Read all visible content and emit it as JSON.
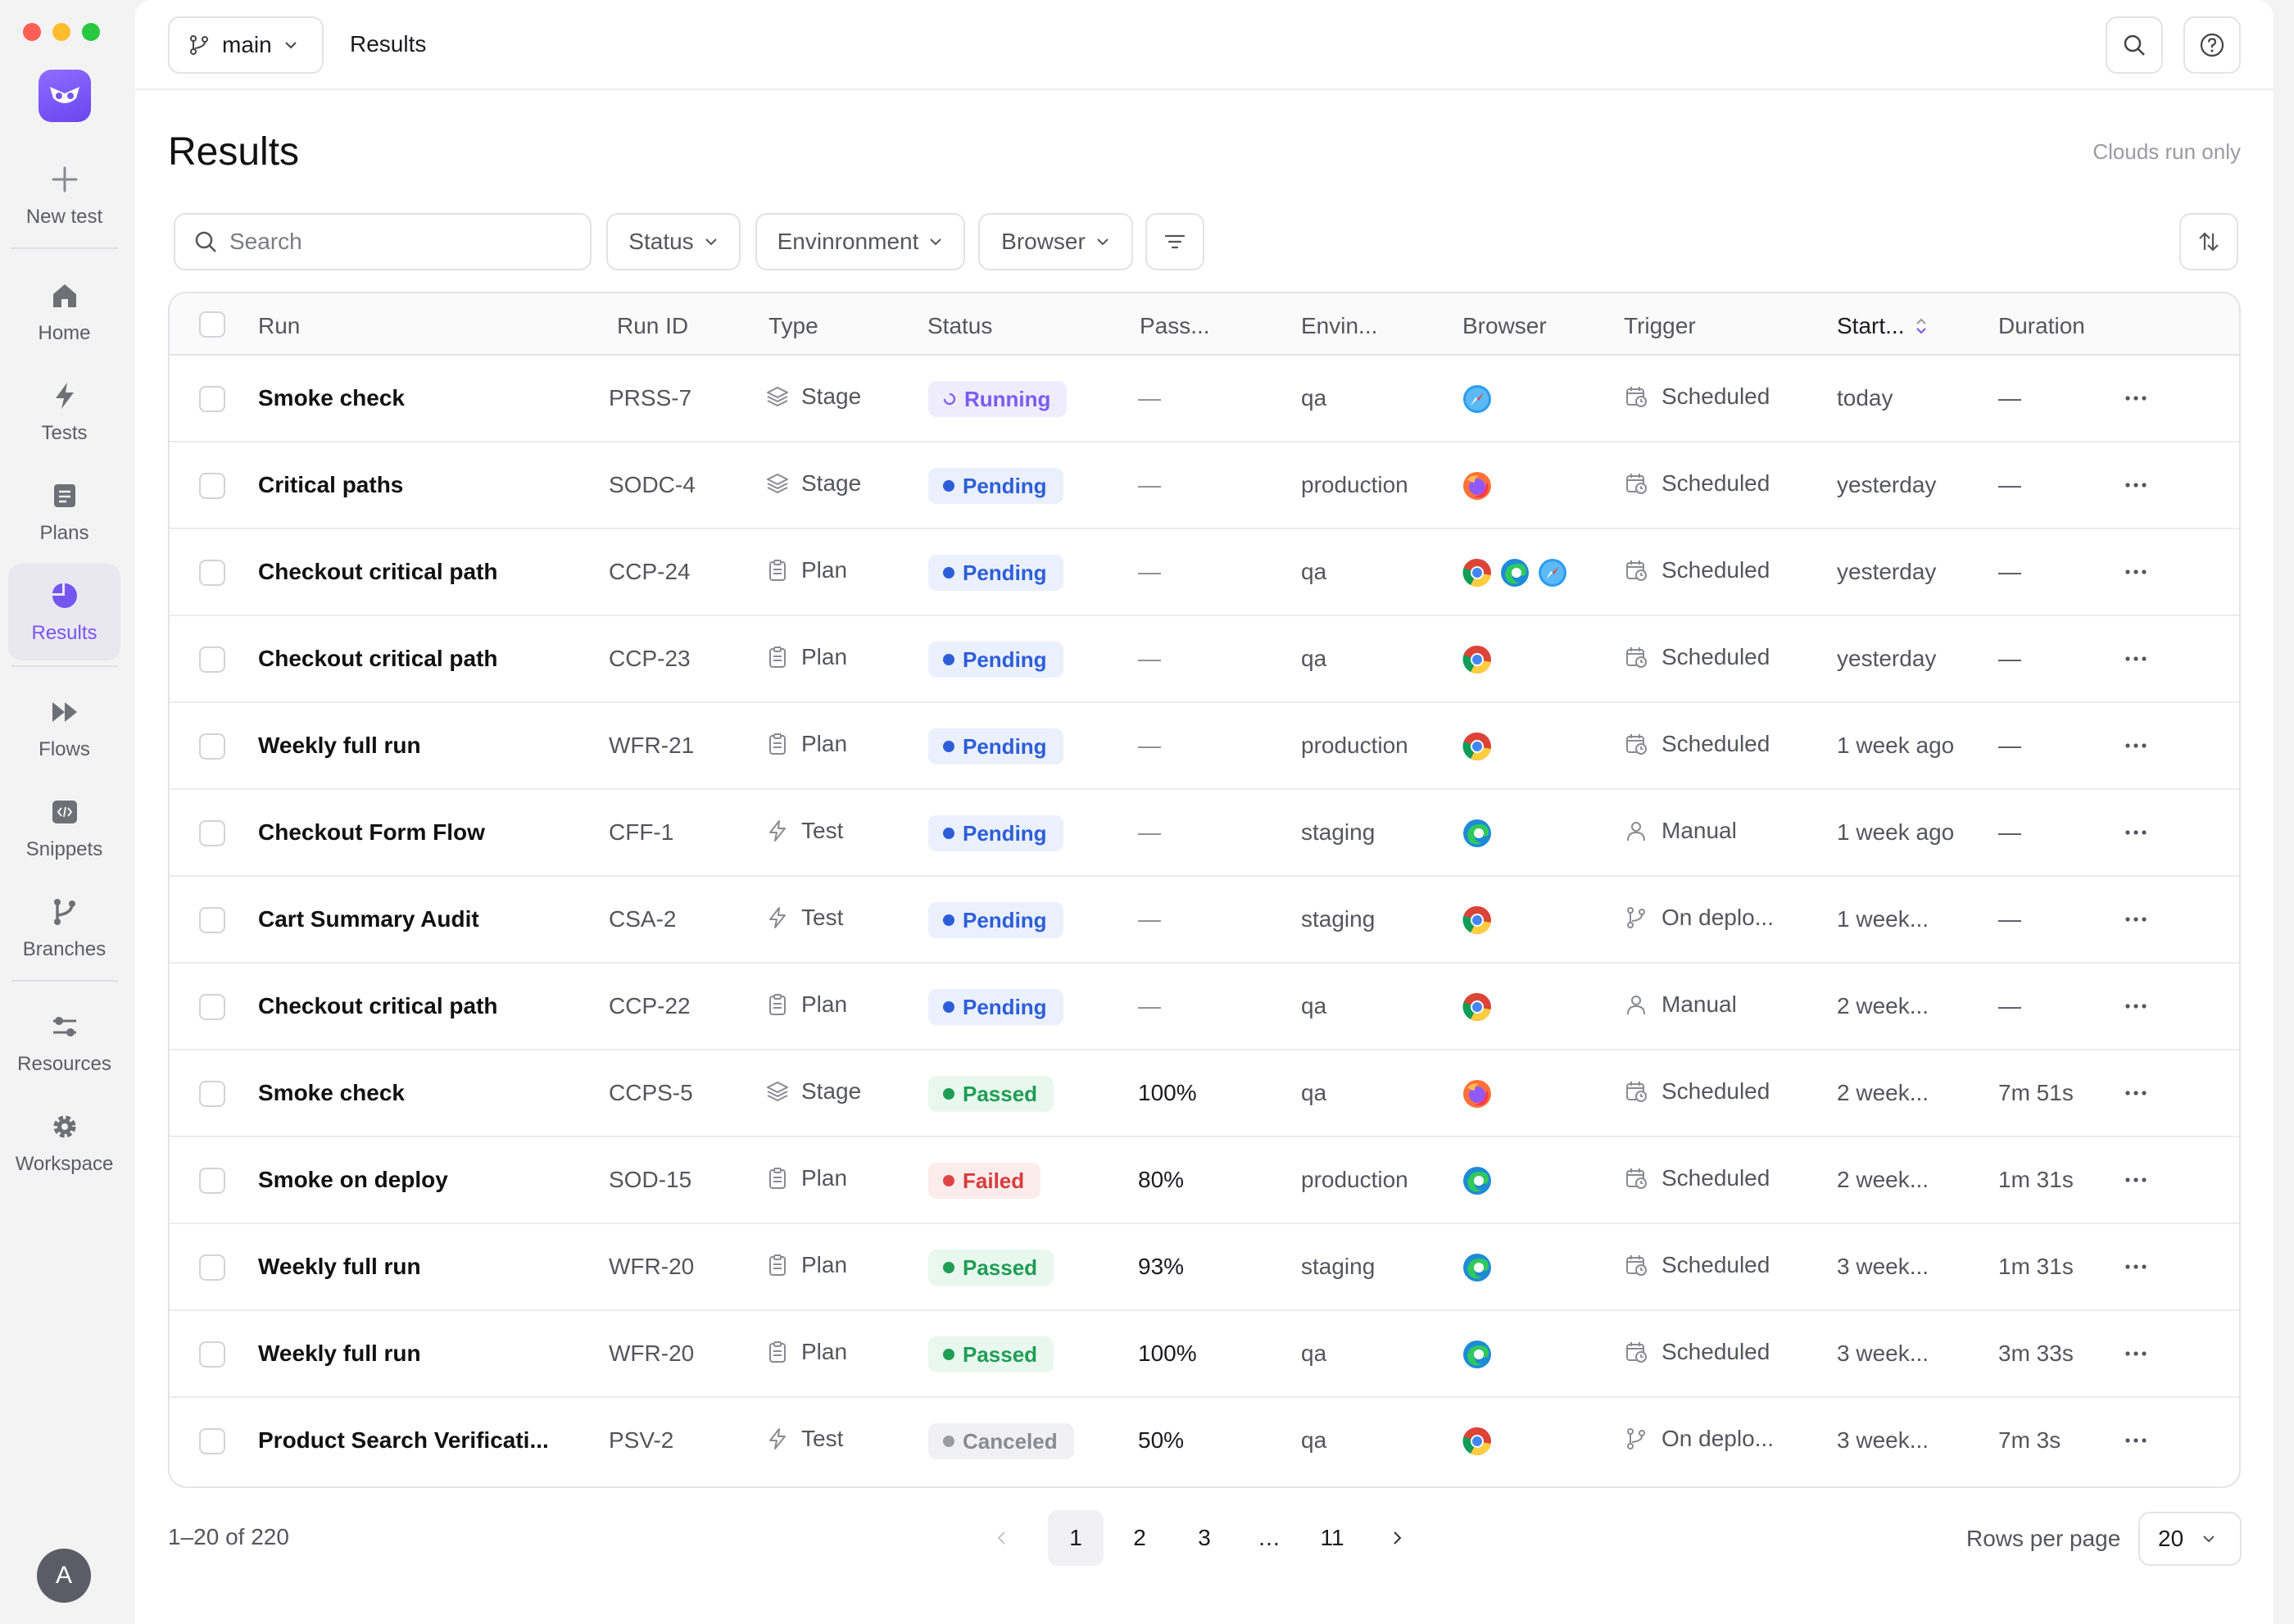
{
  "sidebar": {
    "new_test": "New test",
    "items": [
      {
        "label": "Home"
      },
      {
        "label": "Tests"
      },
      {
        "label": "Plans"
      },
      {
        "label": "Results"
      },
      {
        "label": "Flows"
      },
      {
        "label": "Snippets"
      },
      {
        "label": "Branches"
      },
      {
        "label": "Resources"
      },
      {
        "label": "Workspace"
      }
    ],
    "active": "Results",
    "avatar_initial": "A"
  },
  "topbar": {
    "branch": "main",
    "breadcrumb": "Results"
  },
  "page": {
    "title": "Results",
    "clouds_note": "Clouds run only"
  },
  "filters": {
    "search_placeholder": "Search",
    "status": "Status",
    "environment": "Envinronment",
    "browser": "Browser"
  },
  "table": {
    "headers": {
      "run": "Run",
      "run_id": "Run ID",
      "type": "Type",
      "status": "Status",
      "pass": "Pass...",
      "env": "Envin...",
      "browser": "Browser",
      "trigger": "Trigger",
      "start": "Start...",
      "duration": "Duration"
    },
    "rows": [
      {
        "name": "Smoke check",
        "id": "PRSS-7",
        "type": "Stage",
        "status": "Running",
        "pass": "—",
        "env": "qa",
        "browsers": [
          "safari"
        ],
        "trigger": "Scheduled",
        "start": "today",
        "duration": "—"
      },
      {
        "name": "Critical paths",
        "id": "SODC-4",
        "type": "Stage",
        "status": "Pending",
        "pass": "—",
        "env": "production",
        "browsers": [
          "firefox"
        ],
        "trigger": "Scheduled",
        "start": "yesterday",
        "duration": "—"
      },
      {
        "name": "Checkout critical path",
        "id": "CCP-24",
        "type": "Plan",
        "status": "Pending",
        "pass": "—",
        "env": "qa",
        "browsers": [
          "chrome",
          "edge",
          "safari"
        ],
        "trigger": "Scheduled",
        "start": "yesterday",
        "duration": "—"
      },
      {
        "name": "Checkout critical path",
        "id": "CCP-23",
        "type": "Plan",
        "status": "Pending",
        "pass": "—",
        "env": "qa",
        "browsers": [
          "chrome"
        ],
        "trigger": "Scheduled",
        "start": "yesterday",
        "duration": "—"
      },
      {
        "name": "Weekly full run",
        "id": "WFR-21",
        "type": "Plan",
        "status": "Pending",
        "pass": "—",
        "env": "production",
        "browsers": [
          "chrome"
        ],
        "trigger": "Scheduled",
        "start": "1 week ago",
        "duration": "—"
      },
      {
        "name": "Checkout Form Flow",
        "id": "CFF-1",
        "type": "Test",
        "status": "Pending",
        "pass": "—",
        "env": "staging",
        "browsers": [
          "edge"
        ],
        "trigger": "Manual",
        "start": "1 week ago",
        "duration": "—"
      },
      {
        "name": "Cart Summary Audit",
        "id": "CSA-2",
        "type": "Test",
        "status": "Pending",
        "pass": "—",
        "env": "staging",
        "browsers": [
          "chrome"
        ],
        "trigger": "On deplo...",
        "start": "1 week...",
        "duration": "—"
      },
      {
        "name": "Checkout critical path",
        "id": "CCP-22",
        "type": "Plan",
        "status": "Pending",
        "pass": "—",
        "env": "qa",
        "browsers": [
          "chrome"
        ],
        "trigger": "Manual",
        "start": "2 week...",
        "duration": "—"
      },
      {
        "name": "Smoke check",
        "id": "CCPS-5",
        "type": "Stage",
        "status": "Passed",
        "pass": "100%",
        "env": "qa",
        "browsers": [
          "firefox"
        ],
        "trigger": "Scheduled",
        "start": "2 week...",
        "duration": "7m 51s"
      },
      {
        "name": "Smoke on deploy",
        "id": "SOD-15",
        "type": "Plan",
        "status": "Failed",
        "pass": "80%",
        "env": "production",
        "browsers": [
          "edge"
        ],
        "trigger": "Scheduled",
        "start": "2 week...",
        "duration": "1m 31s"
      },
      {
        "name": "Weekly full run",
        "id": "WFR-20",
        "type": "Plan",
        "status": "Passed",
        "pass": "93%",
        "env": "staging",
        "browsers": [
          "edge"
        ],
        "trigger": "Scheduled",
        "start": "3 week...",
        "duration": "1m 31s"
      },
      {
        "name": "Weekly full run",
        "id": "WFR-20",
        "type": "Plan",
        "status": "Passed",
        "pass": "100%",
        "env": "qa",
        "browsers": [
          "edge"
        ],
        "trigger": "Scheduled",
        "start": "3 week...",
        "duration": "3m 33s"
      },
      {
        "name": "Product Search Verificati...",
        "id": "PSV-2",
        "type": "Test",
        "status": "Canceled",
        "pass": "50%",
        "env": "qa",
        "browsers": [
          "chrome"
        ],
        "trigger": "On deplo...",
        "start": "3 week...",
        "duration": "7m 3s"
      }
    ]
  },
  "pagination": {
    "summary": "1–20 of 220",
    "pages": [
      "1",
      "2",
      "3",
      "…",
      "11"
    ],
    "current": "1",
    "rows_label": "Rows per page",
    "rows_value": "20"
  },
  "colors": {
    "accent": "#7556f0",
    "pending": "#2d5ed8",
    "passed": "#1f9d55",
    "failed": "#d93b3b"
  }
}
